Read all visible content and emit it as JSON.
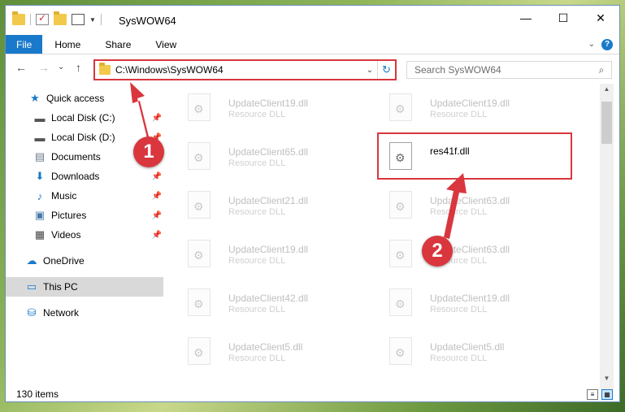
{
  "window": {
    "title": "SysWOW64",
    "controls": {
      "minimize": "—",
      "maximize": "☐",
      "close": "✕"
    }
  },
  "ribbon": {
    "tabs": [
      {
        "label": "File"
      },
      {
        "label": "Home"
      },
      {
        "label": "Share"
      },
      {
        "label": "View"
      }
    ],
    "help": "?"
  },
  "navigation": {
    "back": "←",
    "forward": "→",
    "recent": "⌄",
    "up": "↑",
    "address": "C:\\Windows\\SysWOW64",
    "refresh": "↻",
    "search_placeholder": "Search SysWOW64"
  },
  "sidebar": {
    "items": [
      {
        "label": "Quick access",
        "icon": "star-icon"
      },
      {
        "label": "Local Disk (C:)",
        "icon": "drive-icon",
        "pinned": true
      },
      {
        "label": "Local Disk (D:)",
        "icon": "drive-icon",
        "pinned": true
      },
      {
        "label": "Documents",
        "icon": "documents-icon",
        "pinned": true
      },
      {
        "label": "Downloads",
        "icon": "downloads-icon",
        "pinned": true
      },
      {
        "label": "Music",
        "icon": "music-icon",
        "pinned": true
      },
      {
        "label": "Pictures",
        "icon": "pictures-icon",
        "pinned": true
      },
      {
        "label": "Videos",
        "icon": "videos-icon",
        "pinned": true
      },
      {
        "label": "OneDrive",
        "icon": "onedrive-icon"
      },
      {
        "label": "This PC",
        "icon": "pc-icon",
        "selected": true
      },
      {
        "label": "Network",
        "icon": "network-icon"
      }
    ]
  },
  "files": {
    "left": [
      {
        "name": "UpdateClient19.dll",
        "type": "Resource DLL"
      },
      {
        "name": "UpdateClient65.dll",
        "type": "Resource DLL"
      },
      {
        "name": "UpdateClient21.dll",
        "type": "Resource DLL"
      },
      {
        "name": "UpdateClient19.dll",
        "type": "Resource DLL"
      },
      {
        "name": "UpdateClient42.dll",
        "type": "Resource DLL"
      },
      {
        "name": "UpdateClient5.dll",
        "type": "Resource DLL"
      }
    ],
    "right": [
      {
        "name": "UpdateClient19.dll",
        "type": "Resource DLL"
      },
      {
        "name": "res41f.dll",
        "type": "",
        "highlighted": true
      },
      {
        "name": "UpdateClient63.dll",
        "type": "Resource DLL"
      },
      {
        "name": "UpdateClient63.dll",
        "type": "Resource DLL"
      },
      {
        "name": "UpdateClient19.dll",
        "type": "Resource DLL"
      },
      {
        "name": "UpdateClient5.dll",
        "type": "Resource DLL"
      }
    ]
  },
  "status": {
    "item_count": "130 items"
  },
  "annotations": [
    {
      "label": "1"
    },
    {
      "label": "2"
    }
  ],
  "colors": {
    "accent": "#1979ca",
    "annotation_red": "#d9363e",
    "selection": "#cce8ff"
  }
}
